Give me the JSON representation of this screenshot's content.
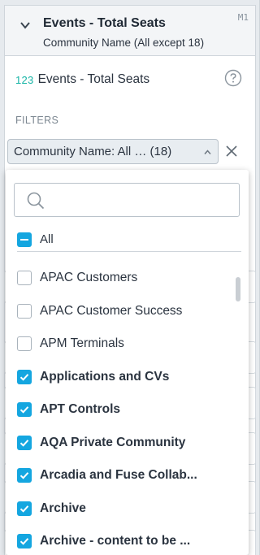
{
  "header": {
    "title": "Events - Total Seats",
    "subtitle": "Community Name (All except 18)",
    "metric_id": "M1",
    "chevron_icon": "chevron-down-icon"
  },
  "metric": {
    "type_badge": "123",
    "label": "Events - Total Seats",
    "help_icon": "help-circle-icon"
  },
  "filters": {
    "section_label": "FILTERS",
    "chip_text": "Community Name: All … (18)",
    "chip_caret_icon": "caret-up-icon",
    "remove_icon": "close-icon"
  },
  "dropdown": {
    "search": {
      "placeholder": "",
      "value": ""
    },
    "select_all": {
      "label": "All",
      "state": "partial"
    },
    "items": [
      {
        "label": "APAC Customers",
        "checked": false
      },
      {
        "label": "APAC Customer Success",
        "checked": false
      },
      {
        "label": "APM Terminals",
        "checked": false
      },
      {
        "label": "Applications and CVs",
        "checked": true
      },
      {
        "label": "APT Controls",
        "checked": true
      },
      {
        "label": "AQA Private Community",
        "checked": true
      },
      {
        "label": "Arcadia and Fuse Collab...",
        "checked": true
      },
      {
        "label": "Archive",
        "checked": true
      },
      {
        "label": "Archive - content to be ...",
        "checked": true
      }
    ]
  },
  "colors": {
    "accent": "#14a6e0",
    "number_badge": "#13b3a4",
    "text": "#2b3440"
  }
}
